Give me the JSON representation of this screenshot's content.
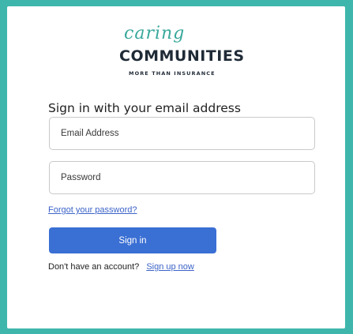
{
  "logo": {
    "script": "caring",
    "wordmark": "COMMUNITIES",
    "tagline": "MORE THAN INSURANCE"
  },
  "heading": "Sign in with your email address",
  "email": {
    "placeholder": "Email Address",
    "value": ""
  },
  "password": {
    "placeholder": "Password",
    "value": ""
  },
  "forgot_link": "Forgot your password?",
  "signin_button": "Sign in",
  "signup": {
    "prompt": "Don't have an account?",
    "link": "Sign up now"
  },
  "colors": {
    "background": "#3fb6ab",
    "primary_button": "#3a6fd4",
    "link": "#3b63c7",
    "logo_accent": "#39a89b"
  }
}
